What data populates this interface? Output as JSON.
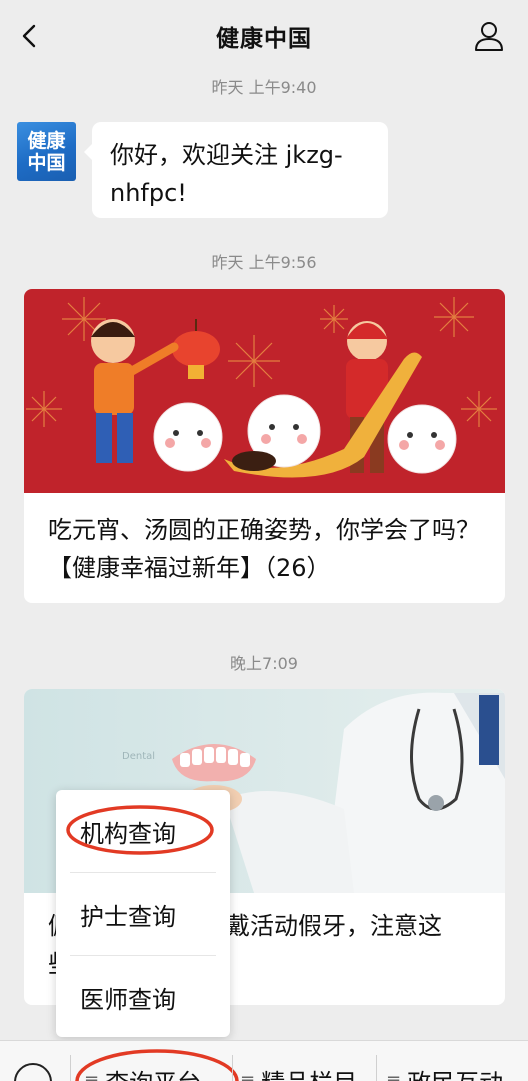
{
  "header": {
    "title": "健康中国"
  },
  "messages": {
    "time1": "昨天 上午9:40",
    "avatar_text": "健康中国",
    "greeting": "你好，欢迎关注 jkzg-nhfpc!",
    "time2": "昨天 上午9:56",
    "article1_title": "吃元宵、汤圆的正确姿势，你学会了吗？【健康幸福过新年】（26）",
    "time3": "晚上7:09",
    "article2_title_visible_start": "佩",
    "article2_title_visible_middle": "戴活动假牙，注意这",
    "article2_title_visible_second_line": "些"
  },
  "popup_menu": {
    "items": [
      "机构查询",
      "护士查询",
      "医师查询"
    ],
    "highlighted_index": 0
  },
  "bottom_menu": {
    "tabs": [
      "查询平台",
      "精品栏目",
      "政民互动"
    ],
    "active_index": 0
  },
  "colors": {
    "highlight_circle": "#e23a24",
    "banner_red": "#c0232b",
    "background": "#ededed"
  }
}
